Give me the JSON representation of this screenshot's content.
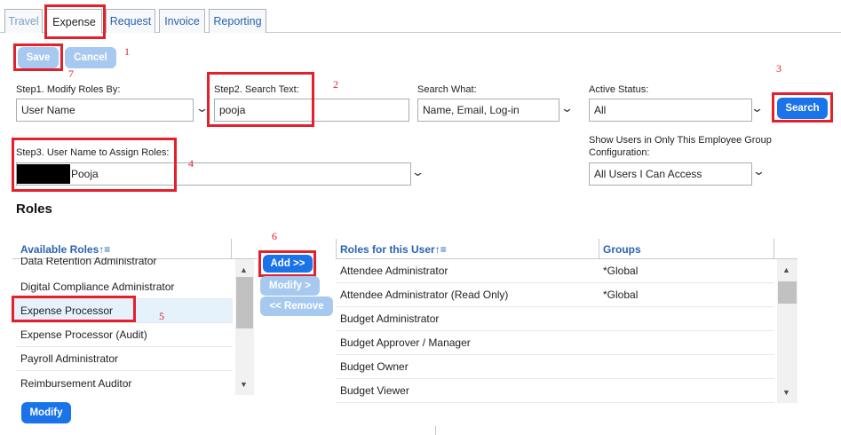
{
  "tabs": [
    "Travel",
    "Expense",
    "Request",
    "Invoice",
    "Reporting"
  ],
  "toolbar": {
    "save_label": "Save",
    "cancel_label": "Cancel"
  },
  "form": {
    "modify_by_label": "Step1. Modify Roles By:",
    "modify_by_value": "User Name",
    "search_text_label": "Step2. Search Text:",
    "search_text_value": "pooja",
    "search_what_label": "Search What:",
    "search_what_value": "Name, Email, Log-in",
    "active_status_label": "Active Status:",
    "active_status_value": "All",
    "search_button": "Search",
    "assign_label": "Step3. User Name to Assign Roles:",
    "assign_value": "Pooja",
    "group_config_label_1": "Show Users in Only This Employee Group",
    "group_config_label_2": "Configuration:",
    "group_config_value": "All Users I Can Access"
  },
  "roles": {
    "heading": "Roles",
    "available_header": "Available Roles",
    "available_items": [
      "Data Retention Administrator",
      "Digital Compliance Administrator",
      "Expense Processor",
      "Expense Processor (Audit)",
      "Payroll Administrator",
      "Reimbursement Auditor"
    ],
    "add_button": "Add >>",
    "modify_button_mid": "Modify >",
    "remove_button": "<< Remove",
    "modify_button": "Modify",
    "user_roles_header": "Roles for this User",
    "groups_header": "Groups",
    "user_roles": [
      {
        "role": "Attendee Administrator",
        "group": "*Global"
      },
      {
        "role": "Attendee Administrator (Read Only)",
        "group": "*Global"
      },
      {
        "role": "Budget Administrator",
        "group": ""
      },
      {
        "role": "Budget Approver / Manager",
        "group": ""
      },
      {
        "role": "Budget Owner",
        "group": ""
      },
      {
        "role": "Budget Viewer",
        "group": ""
      }
    ]
  },
  "annotations": [
    "1",
    "2",
    "3",
    "4",
    "5",
    "6",
    "7"
  ],
  "icons": {
    "sort": "↑≡",
    "chevron": "chevron-down-icon",
    "scroll_up": "▲",
    "scroll_down": "▼"
  },
  "colors": {
    "accent": "#1a73e8",
    "annotation": "#e3202b",
    "link": "#2b63b0"
  }
}
